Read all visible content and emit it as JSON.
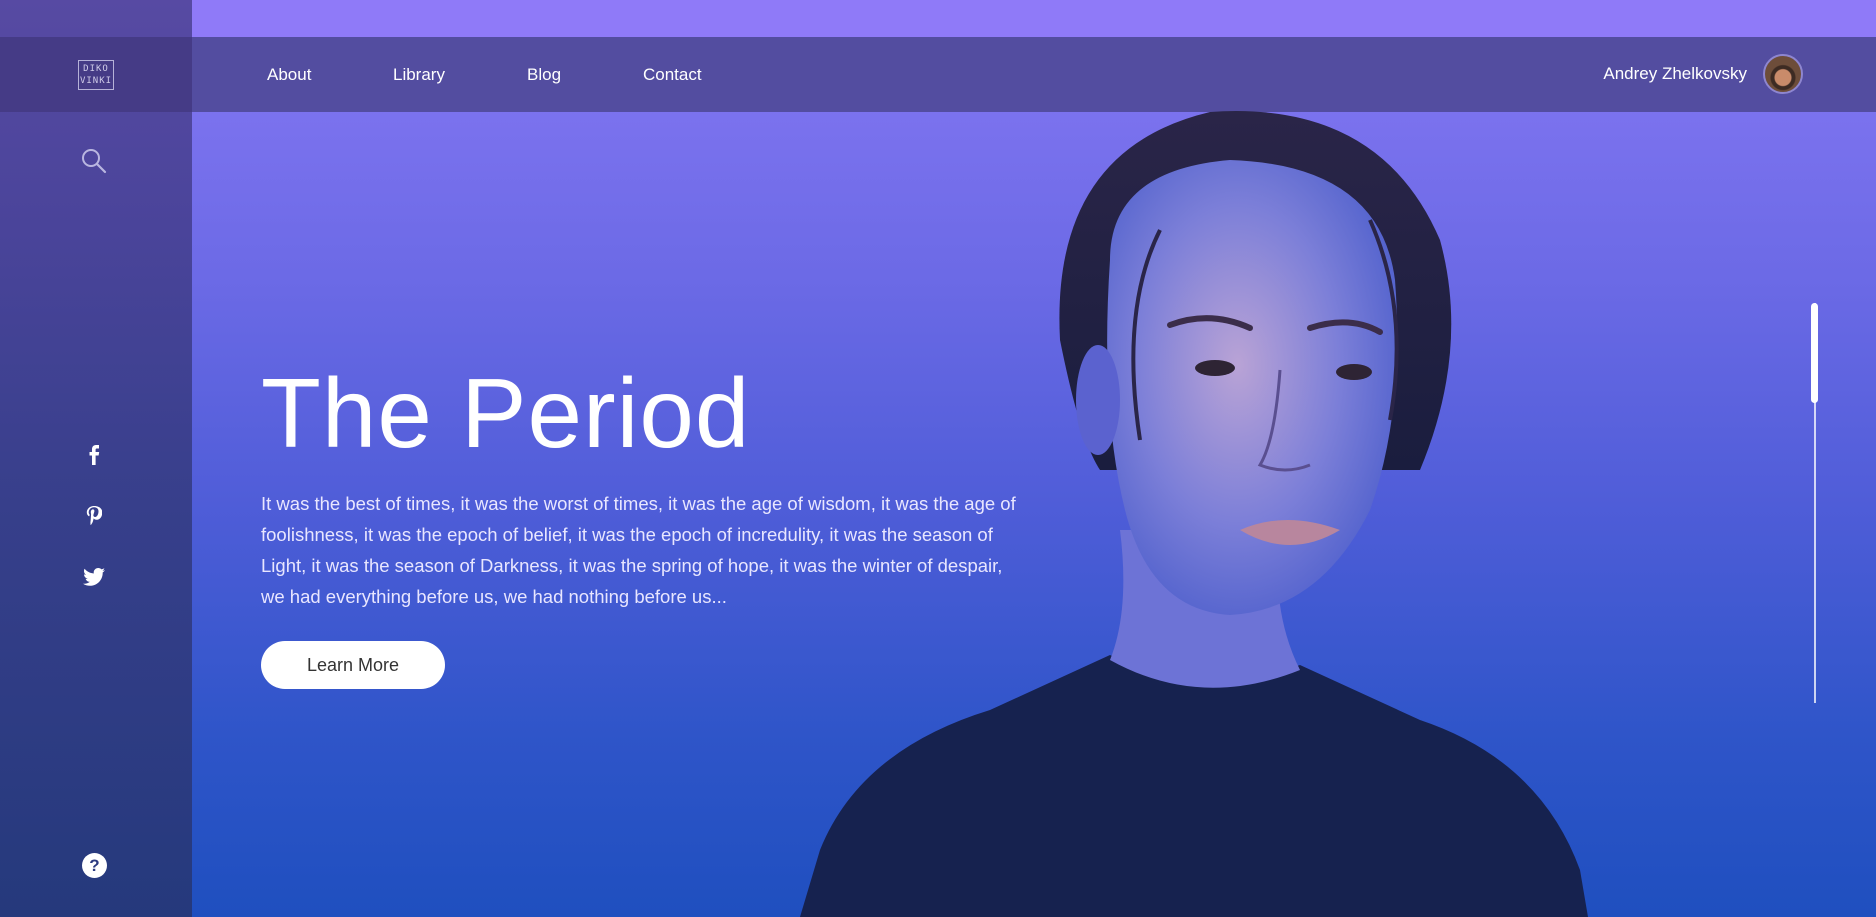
{
  "brand": {
    "logo_text_top": "DIKO",
    "logo_text_bottom": "VINKI"
  },
  "nav": {
    "items": [
      {
        "label": "About"
      },
      {
        "label": "Library"
      },
      {
        "label": "Blog"
      },
      {
        "label": "Contact"
      }
    ]
  },
  "user": {
    "name": "Andrey Zhelkovsky"
  },
  "sidebar": {
    "icons": [
      "search-icon",
      "facebook-icon",
      "pinterest-icon",
      "twitter-icon",
      "help-icon"
    ],
    "social": [
      {
        "glyph": "f"
      },
      {
        "glyph": "p"
      }
    ],
    "help_glyph": "?"
  },
  "hero": {
    "title": "The Period",
    "text": "It was the best of times, it was the worst of times, it was the age of wisdom, it was the age of foolishness, it was the epoch of belief, it was the epoch of incredulity, it was the season of Light, it was the season of Darkness, it was the spring of hope, it was the winter of despair, we had everything before us, we had nothing before us...",
    "cta_label": "Learn More"
  },
  "colors": {
    "gradient_top": "#8a78f5",
    "gradient_bottom": "#1f4fbf",
    "sidebar": "#453b86",
    "navbar": "#534da0",
    "shirt": "#16224f"
  },
  "scroll": {
    "position": 0.0,
    "visible_fraction": 0.25
  }
}
